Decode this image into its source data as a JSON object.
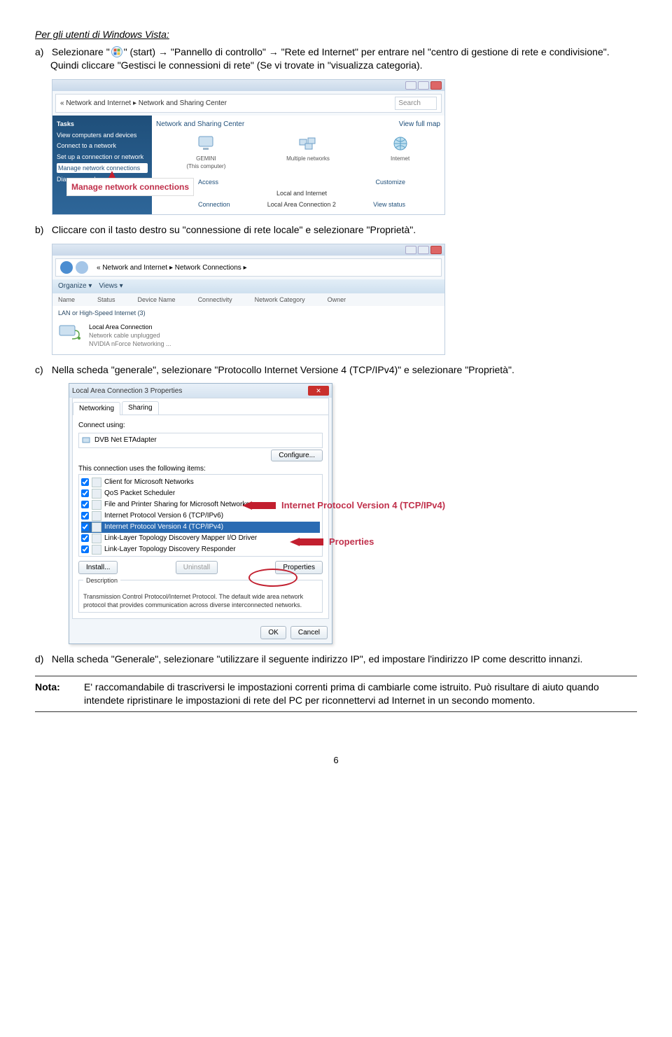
{
  "title": "Per gli utenti di Windows Vista:",
  "steps": {
    "a": {
      "label": "a)",
      "text_1": "Selezionare \"",
      "text_2": "\" (start) → \"Pannello di controllo\" → \"Rete ed Internet\" per entrare nel \"centro di gestione di rete e condivisione\". Quindi cliccare \"Gestisci le connessioni di rete\" (Se vi trovate in \"visualizza categoria)."
    },
    "b": {
      "label": "b)",
      "text": "Cliccare con il tasto destro su \"connessione di rete locale\" e selezionare \"Proprietà\"."
    },
    "c": {
      "label": "c)",
      "text": "Nella scheda \"generale\", selezionare \"Protocollo Internet Versione 4 (TCP/IPv4)\" e selezionare \"Proprietà\"."
    },
    "d": {
      "label": "d)",
      "text": "Nella scheda \"Generale\", selezionare \"utilizzare il seguente indirizzo IP\", ed impostare l'indirizzo IP come descritto innanzi."
    }
  },
  "note": {
    "label": "Nota:",
    "text": "E' raccomandabile di trascriversi le impostazioni correnti prima di cambiarle come istruito. Può risultare di aiuto quando intendete ripristinare le impostazioni di rete del PC per riconnettervi ad Internet in un secondo momento."
  },
  "page_number": "6",
  "ss1": {
    "crumb_path": "« Network and Internet ▸ Network and Sharing Center",
    "search": "Search",
    "tasks_header": "Tasks",
    "sidebar_items": [
      "View computers and devices",
      "Connect to a network",
      "Set up a connection or network",
      "Manage network connections",
      "Diagnose and repair"
    ],
    "main_header": "Network and Sharing Center",
    "view_full_map": "View full map",
    "dev1_name": "GEMINI",
    "dev1_sub": "(This computer)",
    "dev2_name": "Multiple networks",
    "dev3_name": "Internet",
    "row1_l": "Access",
    "row1_r": "Customize",
    "row2_l": "Connection",
    "row2_m1": "Local and Internet",
    "row3_m": "Local Area Connection 2",
    "row3_r": "View status",
    "callout": "Manage network connections"
  },
  "ss2": {
    "crumb_path": "« Network and Internet ▸ Network Connections ▸",
    "tool_org": "Organize ▾",
    "tool_views": "Views ▾",
    "cols": [
      "Name",
      "Status",
      "Device Name",
      "Connectivity",
      "Network Category",
      "Owner"
    ],
    "group": "LAN or High-Speed Internet (3)",
    "item_name": "Local Area Connection",
    "item_line2": "Network cable unplugged",
    "item_line3": "NVIDIA nForce Networking ..."
  },
  "ss3": {
    "title": "Local Area Connection 3 Properties",
    "tab1": "Networking",
    "tab2": "Sharing",
    "connect_using": "Connect using:",
    "adapter": "DVB Net ETAdapter",
    "configure": "Configure...",
    "list_label": "This connection uses the following items:",
    "items": [
      "Client for Microsoft Networks",
      "QoS Packet Scheduler",
      "File and Printer Sharing for Microsoft Networks",
      "Internet Protocol Version 6 (TCP/IPv6)",
      "Internet Protocol Version 4 (TCP/IPv4)",
      "Link-Layer Topology Discovery Mapper I/O Driver",
      "Link-Layer Topology Discovery Responder"
    ],
    "install": "Install...",
    "uninstall": "Uninstall",
    "properties": "Properties",
    "desc_label": "Description",
    "desc_text": "Transmission Control Protocol/Internet Protocol. The default wide area network protocol that provides communication across diverse interconnected networks.",
    "ok": "OK",
    "cancel": "Cancel",
    "annot1": "Internet Protocol Version 4 (TCP/IPv4)",
    "annot2": "Properties"
  }
}
